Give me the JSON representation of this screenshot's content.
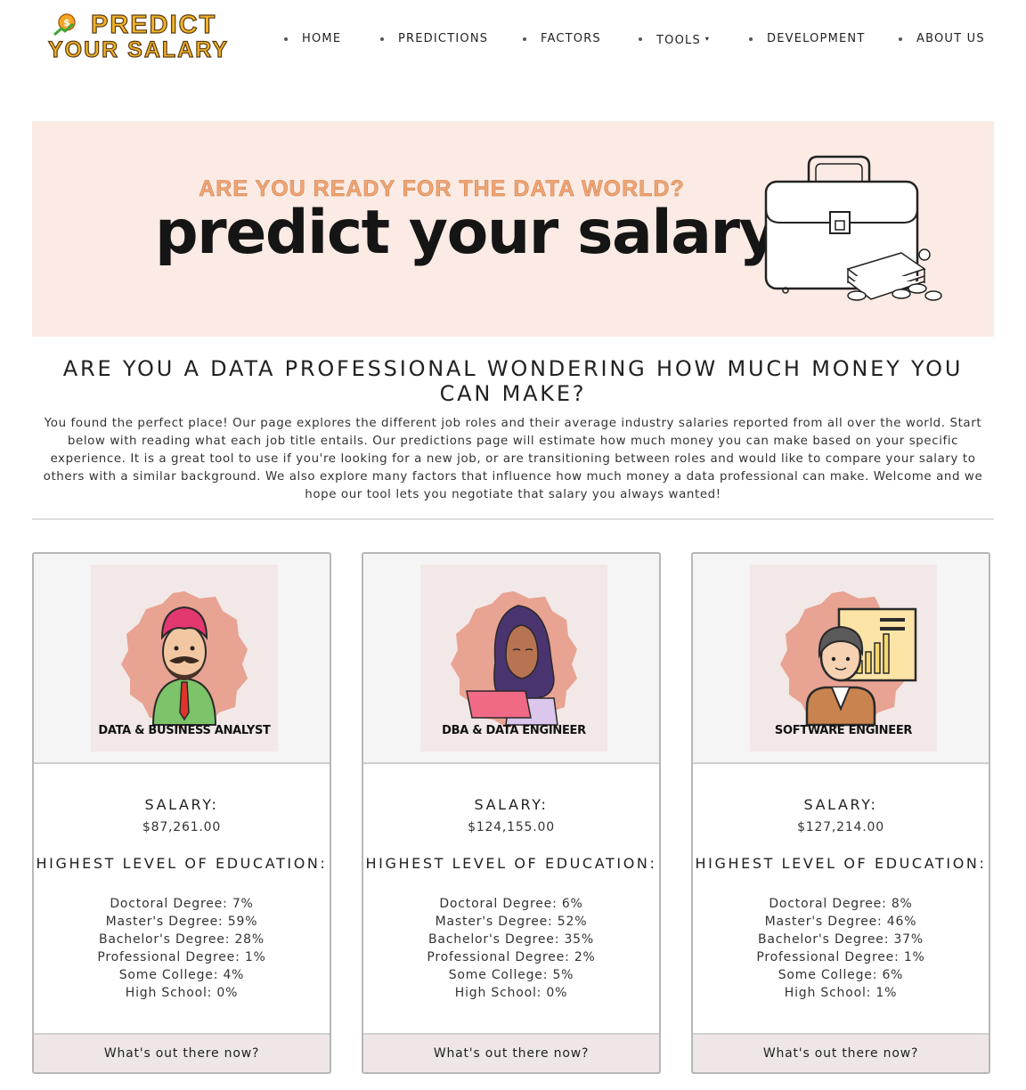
{
  "logo": {
    "line1": "PREDICT",
    "line2": "YOUR SALARY"
  },
  "nav": [
    {
      "label": "HOME"
    },
    {
      "label": "PREDICTIONS"
    },
    {
      "label": "FACTORS"
    },
    {
      "label": "TOOLS"
    },
    {
      "label": "DEVELOPMENT"
    },
    {
      "label": "ABOUT US"
    }
  ],
  "hero": {
    "subtitle": "ARE YOU READY FOR THE DATA WORLD?",
    "title": "predict your salary"
  },
  "headline": "ARE YOU A DATA PROFESSIONAL WONDERING HOW MUCH MONEY YOU CAN MAKE?",
  "intro": "You found the perfect place! Our page explores the different job roles and their average industry salaries reported from all over the world. Start below with reading what each job title entails. Our predictions page will estimate how much money you can make based on your specific experience. It is a great tool to use if you're looking for a new job, or are transitioning between roles and would like to compare your salary to others with a similar background. We also explore many factors that influence how much money a data professional can make. Welcome and we hope our tool lets you negotiate that salary you always wanted!",
  "cards": [
    {
      "role": "DATA & BUSINESS ANALYST",
      "salary_title": "SALARY:",
      "salary": "$87,261.00",
      "edu_title": "HIGHEST LEVEL OF EDUCATION:",
      "edu": [
        "Doctoral Degree: 7%",
        "Master's Degree: 59%",
        "Bachelor's Degree: 28%",
        "Professional Degree: 1%",
        "Some College: 4%",
        "High School: 0%"
      ],
      "button": "What's out there now?"
    },
    {
      "role": "DBA & DATA ENGINEER",
      "salary_title": "SALARY:",
      "salary": "$124,155.00",
      "edu_title": "HIGHEST LEVEL OF EDUCATION:",
      "edu": [
        "Doctoral Degree: 6%",
        "Master's Degree: 52%",
        "Bachelor's Degree: 35%",
        "Professional Degree: 2%",
        "Some College: 5%",
        "High School: 0%"
      ],
      "button": "What's out there now?"
    },
    {
      "role": "SOFTWARE ENGINEER",
      "salary_title": "SALARY:",
      "salary": "$127,214.00",
      "edu_title": "HIGHEST LEVEL OF EDUCATION:",
      "edu": [
        "Doctoral Degree: 8%",
        "Master's Degree: 46%",
        "Bachelor's Degree: 37%",
        "Professional Degree: 1%",
        "Some College: 6%",
        "High School: 1%"
      ],
      "button": "What's out there now?"
    }
  ],
  "colors": {
    "hero_bg": "#fbebe4",
    "logo_fill": "#f0b429",
    "hero_subtitle": "#f0a574",
    "card_footer_bg": "#efe7e7",
    "avatar_badge": "#e8a392"
  }
}
